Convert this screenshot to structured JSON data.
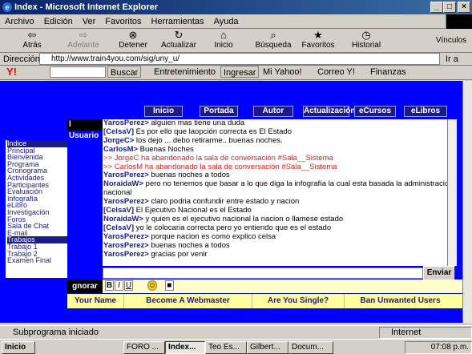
{
  "window": {
    "title": "Index - Microsoft Internet Explorer",
    "min": "_",
    "max": "□",
    "close": "×"
  },
  "menu": [
    "Archivo",
    "Edición",
    "Ver",
    "Favoritos",
    "Herramientas",
    "Ayuda"
  ],
  "toolbar": {
    "back": "Atrás",
    "forward": "Adelante",
    "stop": "Detener",
    "refresh": "Actualizar",
    "home": "Inicio",
    "search": "Búsqueda",
    "favorites": "Favoritos",
    "history": "Historial",
    "links": "Vínculos"
  },
  "address": {
    "label": "Dirección",
    "url": "http://www.train4you.com/sig/uny_u/",
    "go": "Ir a"
  },
  "yahoo": {
    "search": "Buscar",
    "entertainment": "Entretenimiento",
    "login": "Ingresar",
    "myyahoo": "Mi Yahoo!",
    "mail": "Correo Y!",
    "finance": "Finanzas"
  },
  "site": {
    "nav": [
      "Inicio",
      "Portada",
      "Autor",
      "Actualización",
      "eCursos",
      "eLibros"
    ],
    "leftmenu": [
      "Indice",
      "Principal",
      "Bienvenida",
      "Programa",
      "Cronograma",
      "Actividades",
      "Participantes",
      "Evaluación",
      "Infografía",
      "eLibro",
      "Investigación",
      "Foros",
      "Sala de Chat",
      "E-mail",
      "Trabajos",
      "Trabajo 1",
      "Trabajo 2",
      "Examen Final"
    ],
    "chat_header": "l Usuario",
    "chat": [
      {
        "user": "YarosPerez>",
        "text": " alguien mas tiene una duda",
        "sys": false
      },
      {
        "user": "[CelsaV]",
        "text": " Es por ello que laopción correcta es El Estado",
        "sys": false
      },
      {
        "user": "JorgeC>",
        "text": " los dejo ... debo retirarme.. buenas noches.",
        "sys": false
      },
      {
        "user": "CarlosM>",
        "text": " Buenas Noches",
        "sys": false
      },
      {
        "user": "",
        "text": ">> JorgeC ha abandonado la sala de conversación #Sala__Sistema",
        "sys": true
      },
      {
        "user": "",
        "text": ">> CarlosM ha abandonado la sala de conversación #Sala__Sistema",
        "sys": true
      },
      {
        "user": "YarosPerez>",
        "text": " buenas noches a todos",
        "sys": false
      },
      {
        "user": "NoraidaW>",
        "text": " pero no tenemos que basar a lo que diga la infografía la cual esta basada la administracion  en el ejecutivo",
        "sys": false
      },
      {
        "user": "",
        "text": "nacional",
        "sys": false
      },
      {
        "user": "YarosPerez>",
        "text": " claro podria confundir entre estado y nacion",
        "sys": false
      },
      {
        "user": "[CelsaV]",
        "text": " El Ejecutivo Nacional es el Estado",
        "sys": false
      },
      {
        "user": "NoraidaW>",
        "text": " y quien es el ejecutivo nacional la nacion o llamese estado",
        "sys": false
      },
      {
        "user": "[CelsaV]",
        "text": " yo le colocaria correcta pero yo entiendo que es el estado",
        "sys": false
      },
      {
        "user": "YarosPerez>",
        "text": " porque nacion es como explico celsa",
        "sys": false
      },
      {
        "user": "YarosPerez>",
        "text": " buenas noches a todos",
        "sys": false
      },
      {
        "user": "YarosPerez>",
        "text": " gracias por venir",
        "sys": false
      }
    ],
    "send": "Enviar",
    "ignore": "gnorar",
    "fmt": [
      "B",
      "I",
      "U"
    ],
    "banner": [
      "Your Name",
      "Become A Webmaster",
      "Are You Single?",
      "Ban Unwanted Users"
    ]
  },
  "status": {
    "text": "Subprograma iniciado",
    "zone": "Internet"
  },
  "taskbar": {
    "start": "Inicio",
    "tasks": [
      "FORO ...",
      "Index...",
      "Teo Es...",
      "Gilbert...",
      "Docum..."
    ],
    "clock": "07:08 p.m."
  }
}
